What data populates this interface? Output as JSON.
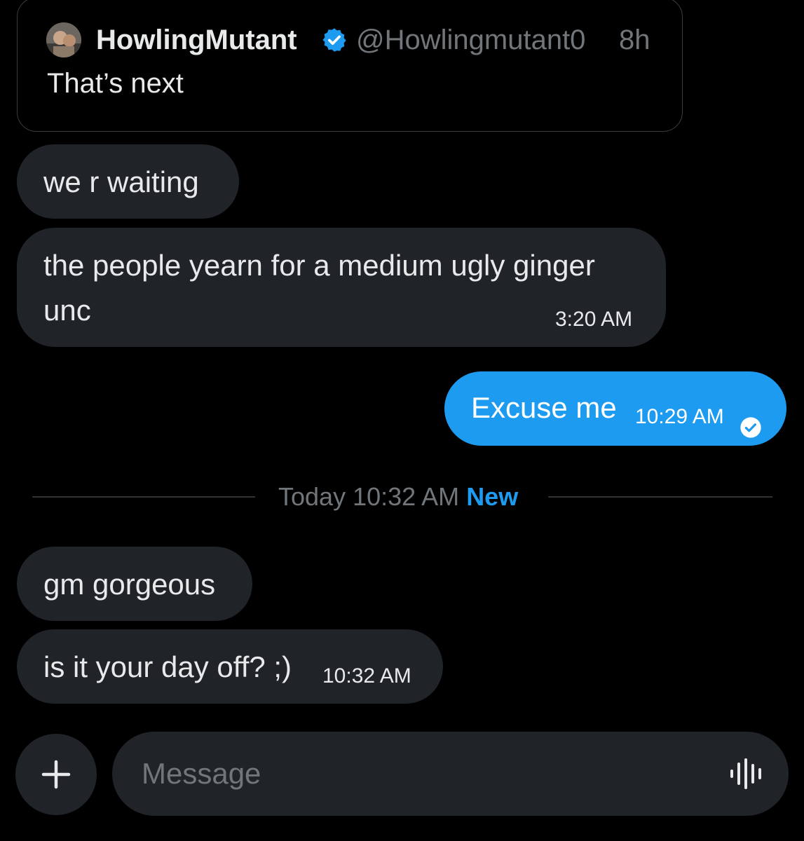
{
  "quoted_post": {
    "display_name": "HowlingMutant",
    "handle": "@Howlingmutant0",
    "age": "8h",
    "text": "That’s next"
  },
  "messages": [
    {
      "direction": "incoming",
      "text": "we r waiting"
    },
    {
      "direction": "incoming",
      "lines": [
        "the people yearn for a medium ugly ginger",
        "unc"
      ],
      "time": "3:20 AM"
    },
    {
      "direction": "outgoing",
      "text": "Excuse me",
      "time": "10:29 AM",
      "status": "read"
    },
    {
      "direction": "incoming",
      "text": "gm gorgeous"
    },
    {
      "direction": "incoming",
      "text": "is it your day off? ;)",
      "time": "10:32 AM"
    }
  ],
  "divider": {
    "label": "Today 10:32 AM",
    "new_label": "New"
  },
  "composer": {
    "placeholder": "Message"
  },
  "icons": {
    "attach": "plus-icon",
    "voice": "voice-waveform-icon",
    "verified": "verified-badge-icon",
    "read": "checkmark-circle-icon"
  },
  "colors": {
    "background": "#000000",
    "bubble_incoming": "#202327",
    "bubble_outgoing": "#1d9bf0",
    "accent": "#1d9bf0",
    "muted_text": "#71767b"
  }
}
